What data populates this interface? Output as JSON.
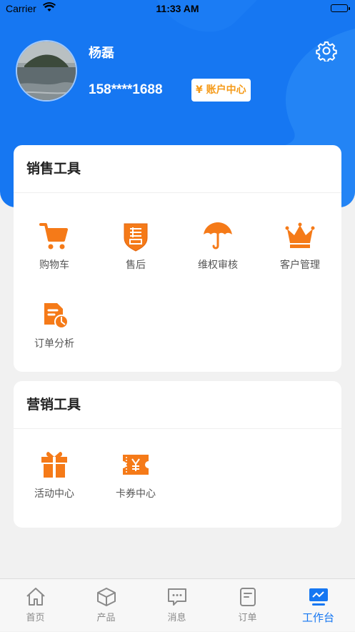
{
  "status_bar": {
    "carrier": "Carrier",
    "time": "11:33 AM"
  },
  "profile": {
    "name": "杨磊",
    "phone": "158****1688",
    "account_button": "¥ 账户中心"
  },
  "sales_tools": {
    "title": "销售工具",
    "items": [
      {
        "label": "购物车",
        "icon": "shopping-cart-icon"
      },
      {
        "label": "售后",
        "icon": "after-sale-shield-icon"
      },
      {
        "label": "维权审核",
        "icon": "umbrella-icon"
      },
      {
        "label": "客户管理",
        "icon": "crown-icon"
      },
      {
        "label": "订单分析",
        "icon": "order-analysis-icon"
      }
    ]
  },
  "marketing_tools": {
    "title": "营销工具",
    "items": [
      {
        "label": "活动中心",
        "icon": "gift-icon"
      },
      {
        "label": "卡券中心",
        "icon": "coupon-icon"
      }
    ]
  },
  "tabbar": {
    "items": [
      {
        "label": "首页",
        "icon": "home-icon",
        "active": false
      },
      {
        "label": "产品",
        "icon": "box-icon",
        "active": false
      },
      {
        "label": "消息",
        "icon": "message-icon",
        "active": false
      },
      {
        "label": "订单",
        "icon": "order-icon",
        "active": false
      },
      {
        "label": "工作台",
        "icon": "workbench-icon",
        "active": true
      }
    ]
  },
  "colors": {
    "brand_blue": "#1677f2",
    "accent_orange": "#f57a18",
    "background": "#f1f1f1"
  }
}
